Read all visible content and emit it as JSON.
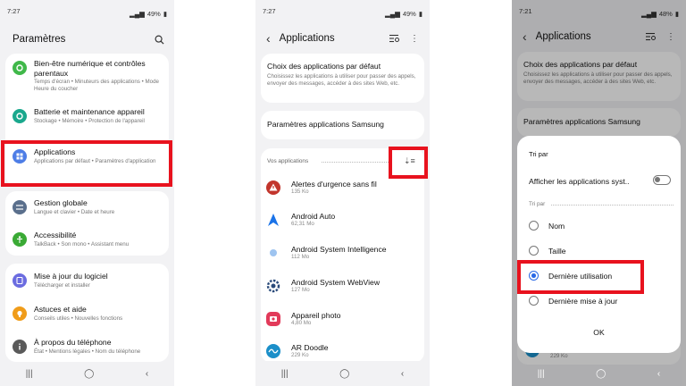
{
  "screen1": {
    "status_time": "7:27",
    "status_battery": "49%",
    "title": "Paramètres",
    "items": [
      {
        "title": "Bien-être numérique et contrôles parentaux",
        "sub": "Temps d'écran • Minuteurs des applications • Mode Heure du coucher",
        "color": "#40b84a"
      },
      {
        "title": "Batterie et maintenance appareil",
        "sub": "Stockage • Mémoire • Protection de l'appareil",
        "color": "#1aa88d"
      },
      {
        "title": "Applications",
        "sub": "Applications par défaut • Paramètres d'application",
        "color": "#4d7de6"
      },
      {
        "title": "Gestion globale",
        "sub": "Langue et clavier • Date et heure",
        "color": "#5a6f8c"
      },
      {
        "title": "Accessibilité",
        "sub": "TalkBack • Son mono • Assistant menu",
        "color": "#3aaa35"
      },
      {
        "title": "Mise à jour du logiciel",
        "sub": "Télécharger et installer",
        "color": "#6b6ce0"
      },
      {
        "title": "Astuces et aide",
        "sub": "Conseils utiles • Nouvelles fonctions",
        "color": "#f09c1a"
      },
      {
        "title": "À propos du téléphone",
        "sub": "État • Mentions légales • Nom du téléphone",
        "color": "#5a5a5a"
      }
    ]
  },
  "screen2": {
    "status_time": "7:27",
    "status_battery": "49%",
    "title": "Applications",
    "default_apps_title": "Choix des applications par défaut",
    "default_apps_sub": "Choisissez les applications à utiliser pour passer des appels, envoyer des messages, accéder à des sites Web, etc.",
    "samsung_settings": "Paramètres applications Samsung",
    "your_apps": "Vos applications",
    "apps": [
      {
        "name": "Alertes d'urgence sans fil",
        "size": "135 Ko",
        "color": "#c2352c"
      },
      {
        "name": "Android Auto",
        "size": "62,31 Mo",
        "color": "#1a73e8"
      },
      {
        "name": "Android System Intelligence",
        "size": "112 Mo",
        "color": "#9ec4f0"
      },
      {
        "name": "Android System WebView",
        "size": "127 Mo",
        "color": "#2a4a7a"
      },
      {
        "name": "Appareil photo",
        "size": "4,80 Mo",
        "color": "#e23a5a"
      },
      {
        "name": "AR Doodle",
        "size": "229 Ko",
        "color": "#1b8fc9"
      }
    ]
  },
  "screen3": {
    "status_time": "7:21",
    "status_battery": "48%",
    "title": "Applications",
    "default_apps_title": "Choix des applications par défaut",
    "default_apps_sub": "Choisissez les applications à utiliser pour passer des appels, envoyer des messages, accéder à des sites Web, etc.",
    "samsung_settings": "Paramètres applications Samsung",
    "bottom_size": "229 Ko",
    "sheet_title": "Tri par",
    "show_system": "Afficher les applications syst..",
    "sort_section": "Tri par",
    "options": [
      "Nom",
      "Taille",
      "Dernière utilisation",
      "Dernière mise à jour"
    ],
    "selected_option": "Dernière utilisation",
    "ok": "OK",
    "accent": "#2a69e6"
  }
}
